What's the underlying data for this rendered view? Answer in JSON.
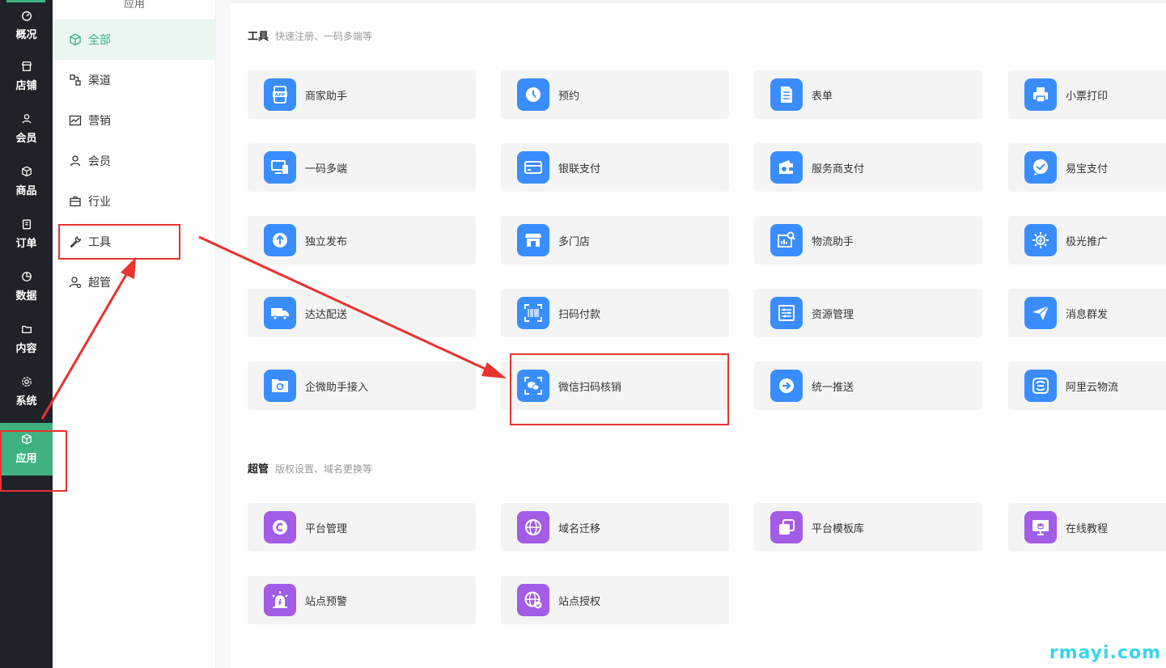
{
  "nav": {
    "items": [
      {
        "label": "概况",
        "icon": "dashboard-icon"
      },
      {
        "label": "店铺",
        "icon": "store-icon"
      },
      {
        "label": "会员",
        "icon": "user-icon"
      },
      {
        "label": "商品",
        "icon": "box-icon"
      },
      {
        "label": "订单",
        "icon": "clipboard-icon"
      },
      {
        "label": "数据",
        "icon": "pie-chart-icon"
      },
      {
        "label": "内容",
        "icon": "folder-icon"
      },
      {
        "label": "系统",
        "icon": "gear-icon"
      },
      {
        "label": "应用",
        "icon": "cube-icon",
        "active": true
      }
    ]
  },
  "submenu": {
    "title": "应用",
    "items": [
      {
        "label": "全部",
        "icon": "cube-icon",
        "active": true
      },
      {
        "label": "渠道",
        "icon": "channel-icon"
      },
      {
        "label": "营销",
        "icon": "trend-icon"
      },
      {
        "label": "会员",
        "icon": "user-icon"
      },
      {
        "label": "行业",
        "icon": "briefcase-icon"
      },
      {
        "label": "工具",
        "icon": "wrench-icon"
      },
      {
        "label": "超管",
        "icon": "admin-icon"
      }
    ]
  },
  "sections": {
    "tools": {
      "title": "工具",
      "desc": "快速注册、一码多端等",
      "cards": [
        {
          "label": "商家助手",
          "icon": "app-icon"
        },
        {
          "label": "预约",
          "icon": "clock-icon"
        },
        {
          "label": "表单",
          "icon": "form-icon"
        },
        {
          "label": "小票打印",
          "icon": "printer-icon"
        },
        {
          "label": "一码多端",
          "icon": "devices-icon"
        },
        {
          "label": "银联支付",
          "icon": "card-icon"
        },
        {
          "label": "服务商支付",
          "icon": "wallet-icon"
        },
        {
          "label": "易宝支付",
          "icon": "chat-check-icon"
        },
        {
          "label": "独立发布",
          "icon": "upload-icon"
        },
        {
          "label": "多门店",
          "icon": "shop-icon"
        },
        {
          "label": "物流助手",
          "icon": "logistics-search-icon"
        },
        {
          "label": "极光推广",
          "icon": "sun-icon"
        },
        {
          "label": "达达配送",
          "icon": "truck-icon"
        },
        {
          "label": "扫码付款",
          "icon": "barcode-scan-icon"
        },
        {
          "label": "资源管理",
          "icon": "sliders-icon"
        },
        {
          "label": "消息群发",
          "icon": "send-icon"
        },
        {
          "label": "企微助手接入",
          "icon": "folder-sync-icon"
        },
        {
          "label": "微信扫码核销",
          "icon": "wechat-scan-icon"
        },
        {
          "label": "统一推送",
          "icon": "arrow-right-circle-icon"
        },
        {
          "label": "阿里云物流",
          "icon": "cloud-logistics-icon"
        }
      ]
    },
    "admin": {
      "title": "超管",
      "desc": "版权设置、域名更换等",
      "cards": [
        {
          "label": "平台管理",
          "icon": "copyright-icon"
        },
        {
          "label": "域名迁移",
          "icon": "globe-move-icon"
        },
        {
          "label": "平台模板库",
          "icon": "layers-icon"
        },
        {
          "label": "在线教程",
          "icon": "monitor-grad-icon"
        },
        {
          "label": "站点预警",
          "icon": "alarm-icon"
        },
        {
          "label": "站点授权",
          "icon": "globe-check-icon"
        }
      ]
    }
  },
  "colors": {
    "accent": "#3fb27f",
    "icon_blue": "#3a8dff",
    "icon_purple": "#a25ce6",
    "annotation_red": "#e8332f"
  },
  "watermark": "rmayi.com"
}
